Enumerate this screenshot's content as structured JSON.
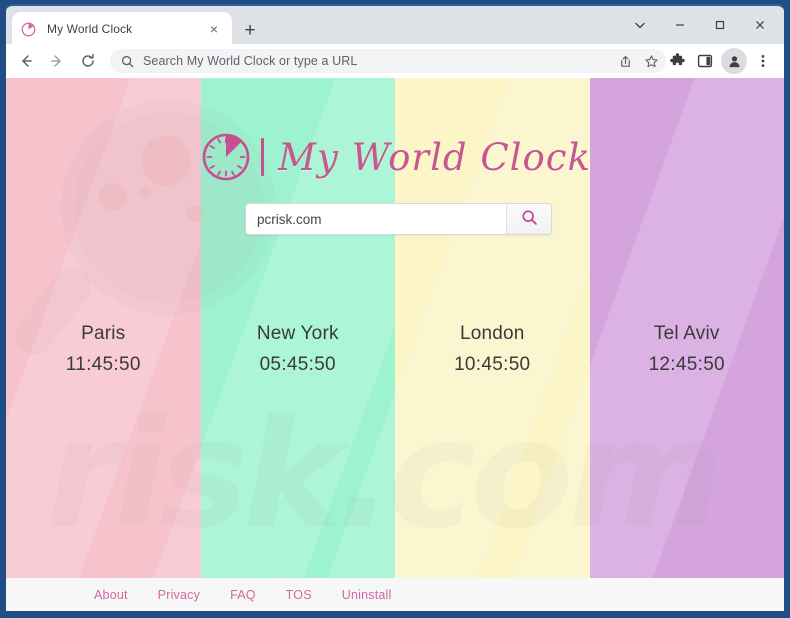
{
  "browser": {
    "tab": {
      "title": "My World Clock",
      "favicon": "clock-icon",
      "close_label": "×"
    },
    "new_tab_label": "+",
    "window_controls": {
      "dropdown": "⌄",
      "minimize": "–",
      "maximize": "□",
      "close": "✕"
    },
    "nav": {
      "back": "←",
      "forward": "→",
      "reload": "⟳"
    },
    "omnibox": {
      "placeholder": "Search My World Clock or type a URL",
      "value": "",
      "icon": "search-icon"
    },
    "toolbar_icons": [
      "share-icon",
      "bookmark-star-icon",
      "extensions-puzzle-icon",
      "side-panel-icon",
      "profile-avatar-icon",
      "three-dot-menu-icon"
    ]
  },
  "page": {
    "logo": {
      "icon": "clock-icon",
      "text": "My World Clock"
    },
    "search": {
      "value": "pcrisk.com",
      "placeholder": "",
      "button_icon": "search-icon"
    },
    "cities": [
      {
        "name": "Paris",
        "time": "11:45:50",
        "bg": "#f6c3cd"
      },
      {
        "name": "New York",
        "time": "05:45:50",
        "bg": "#9df3cf"
      },
      {
        "name": "London",
        "time": "10:45:50",
        "bg": "#fbf5c7"
      },
      {
        "name": "Tel Aviv",
        "time": "12:45:50",
        "bg": "#d5a4de"
      }
    ],
    "watermark": {
      "text": "risk.com",
      "glass": "magnifier-watermark"
    },
    "footer": {
      "links": [
        {
          "label": "About"
        },
        {
          "label": "Privacy"
        },
        {
          "label": "FAQ"
        },
        {
          "label": "TOS"
        },
        {
          "label": "Uninstall"
        }
      ]
    }
  },
  "colors": {
    "frame": "#1f4e87",
    "tabstrip": "#dee1e6",
    "accent_pink": "#c4588f",
    "footer_link": "#d06a9d",
    "text_dark": "#3a3a3a"
  }
}
